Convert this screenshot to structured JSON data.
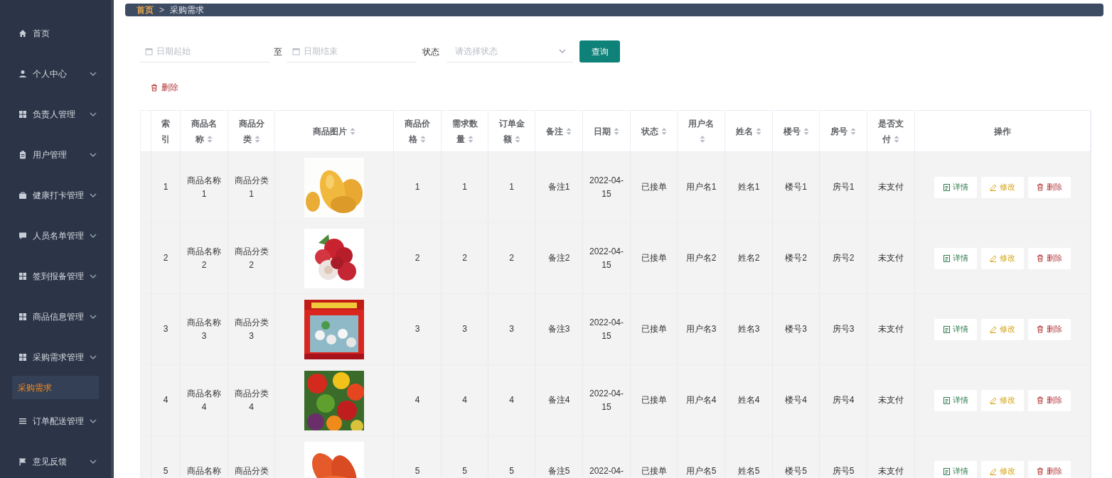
{
  "sidebar": {
    "items": [
      {
        "label": "首页",
        "kind": "link"
      },
      {
        "label": "个人中心",
        "kind": "menu"
      },
      {
        "label": "负责人管理",
        "kind": "menu"
      },
      {
        "label": "用户管理",
        "kind": "menu"
      },
      {
        "label": "健康打卡管理",
        "kind": "menu"
      },
      {
        "label": "人员名单管理",
        "kind": "menu"
      },
      {
        "label": "签到报备管理",
        "kind": "menu"
      },
      {
        "label": "商品信息管理",
        "kind": "menu"
      },
      {
        "label": "采购需求管理",
        "kind": "menu",
        "children": [
          {
            "label": "采购需求",
            "selected": true
          }
        ]
      },
      {
        "label": "订单配送管理",
        "kind": "menu"
      },
      {
        "label": "意见反馈",
        "kind": "menu"
      }
    ]
  },
  "breadcrumb": {
    "home": "首页",
    "separator": ">",
    "current": "采购需求"
  },
  "filters": {
    "date_start": {
      "placeholder": "日期起始"
    },
    "to_label": "至",
    "date_end": {
      "placeholder": "日期结束"
    },
    "status_label": "状态",
    "status_select": {
      "placeholder": "请选择状态"
    },
    "query_button": "查询"
  },
  "delete_button": "删除",
  "table": {
    "columns": [
      {
        "label": "索引",
        "sortable": false
      },
      {
        "label": "商品名称",
        "sortable": true
      },
      {
        "label": "商品分类",
        "sortable": true
      },
      {
        "label": "商品图片",
        "sortable": true
      },
      {
        "label": "商品价格",
        "sortable": true
      },
      {
        "label": "需求数量",
        "sortable": true
      },
      {
        "label": "订单金额",
        "sortable": true
      },
      {
        "label": "备注",
        "sortable": true
      },
      {
        "label": "日期",
        "sortable": true
      },
      {
        "label": "状态",
        "sortable": true
      },
      {
        "label": "用户名",
        "sortable": true
      },
      {
        "label": "姓名",
        "sortable": true
      },
      {
        "label": "楼号",
        "sortable": true
      },
      {
        "label": "房号",
        "sortable": true
      },
      {
        "label": "是否支付",
        "sortable": true
      },
      {
        "label": "操作",
        "sortable": false
      }
    ],
    "rows": [
      {
        "cells": [
          "1",
          "商品名称1",
          "商品分类1",
          {
            "kind": "picture"
          },
          "1",
          "1",
          "1",
          "备注1",
          "2022-04-15",
          "已接单",
          "用户名1",
          "姓名1",
          "楼号1",
          "房号1",
          "未支付",
          {
            "actions": [
              {
                "kind": "detail",
                "label": "详情"
              },
              {
                "kind": "edit",
                "label": "修改"
              },
              {
                "kind": "delete",
                "label": "删除"
              }
            ]
          }
        ]
      },
      {
        "cells": [
          "2",
          "商品名称2",
          "商品分类2",
          {
            "kind": "picture"
          },
          "2",
          "2",
          "2",
          "备注2",
          "2022-04-15",
          "已接单",
          "用户名2",
          "姓名2",
          "楼号2",
          "房号2",
          "未支付",
          {
            "actions": [
              {
                "kind": "detail",
                "label": "详情"
              },
              {
                "kind": "edit",
                "label": "修改"
              },
              {
                "kind": "delete",
                "label": "删除"
              }
            ]
          }
        ]
      },
      {
        "cells": [
          "3",
          "商品名称3",
          "商品分类3",
          {
            "kind": "picture"
          },
          "3",
          "3",
          "3",
          "备注3",
          "2022-04-15",
          "已接单",
          "用户名3",
          "姓名3",
          "楼号3",
          "房号3",
          "未支付",
          {
            "actions": [
              {
                "kind": "detail",
                "label": "详情"
              },
              {
                "kind": "edit",
                "label": "修改"
              },
              {
                "kind": "delete",
                "label": "删除"
              }
            ]
          }
        ]
      },
      {
        "cells": [
          "4",
          "商品名称4",
          "商品分类4",
          {
            "kind": "picture"
          },
          "4",
          "4",
          "4",
          "备注4",
          "2022-04-15",
          "已接单",
          "用户名4",
          "姓名4",
          "楼号4",
          "房号4",
          "未支付",
          {
            "actions": [
              {
                "kind": "detail",
                "label": "详情"
              },
              {
                "kind": "edit",
                "label": "修改"
              },
              {
                "kind": "delete",
                "label": "删除"
              }
            ]
          }
        ]
      },
      {
        "cells": [
          "5",
          "商品名称",
          "商品分类",
          {
            "kind": "picture"
          },
          "5",
          "5",
          "5",
          "备注5",
          "2022-04-",
          "已接单",
          "用户名5",
          "姓名5",
          "楼号5",
          "房号5",
          "未支付",
          {
            "actions": [
              {
                "kind": "detail",
                "label": "详情"
              },
              {
                "kind": "edit",
                "label": "修改"
              },
              {
                "kind": "delete",
                "label": "删除"
              }
            ]
          }
        ]
      }
    ]
  }
}
